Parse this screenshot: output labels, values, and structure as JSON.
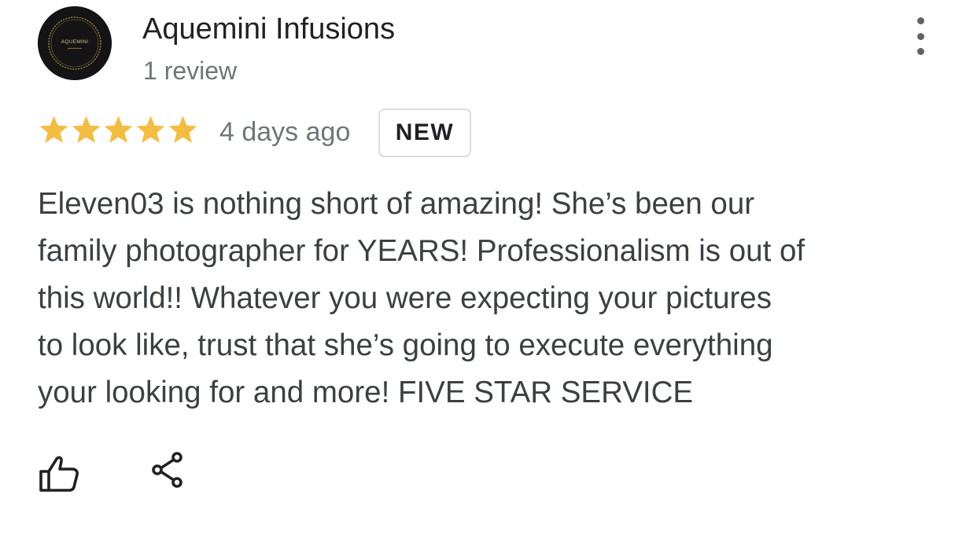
{
  "author": {
    "name": "Aquemini Infusions",
    "review_count": "1 review",
    "avatar_text": "AQUEMINI"
  },
  "review": {
    "rating": 5,
    "rating_max": 5,
    "date": "4 days ago",
    "badge": "NEW",
    "text_lines": [
      "Eleven03 is nothing short of amazing! She’s been our",
      "family photographer for YEARS! Professionalism is out of",
      "this world!! Whatever you were expecting your pictures",
      "to look like, trust that she’s going to execute everything",
      "your looking for and more! FIVE STAR SERVICE"
    ]
  },
  "actions": {
    "like_icon": "thumbs-up-icon",
    "share_icon": "share-icon",
    "more_icon": "more-vert-icon"
  },
  "colors": {
    "star": "#f4bc41",
    "avatar_bg": "#141414",
    "avatar_accent": "#b89a4e",
    "name_text": "#202124",
    "secondary_text": "#70757a",
    "body_text": "#3c4043"
  }
}
